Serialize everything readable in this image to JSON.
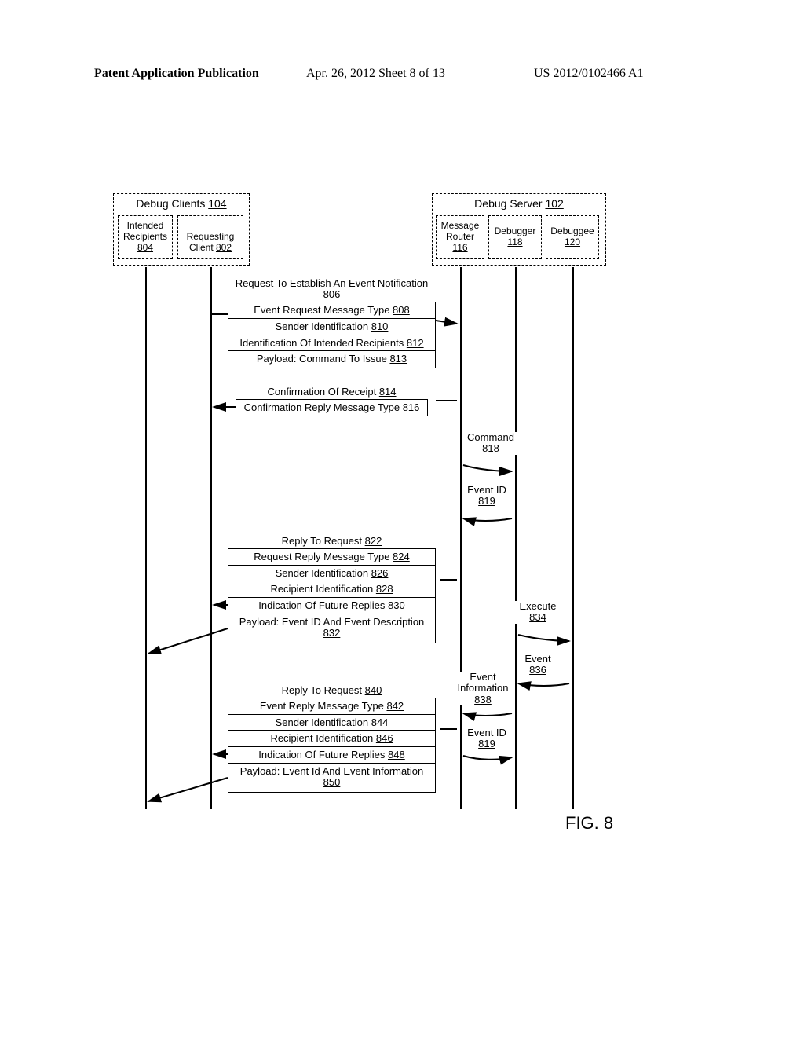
{
  "header": {
    "left": "Patent Application Publication",
    "mid": "Apr. 26, 2012  Sheet 8 of 13",
    "right": "US 2012/0102466 A1"
  },
  "clients": {
    "title": "Debug Clients ",
    "ref": "104",
    "intended_label": "Intended\nRecipients",
    "intended_ref": "804",
    "requesting_label": "Requesting\nClient ",
    "requesting_ref": "802"
  },
  "server": {
    "title": "Debug Server ",
    "ref": "102",
    "router_label": "Message\nRouter",
    "router_ref": "116",
    "debugger_label": "Debugger",
    "debugger_ref": "118",
    "debuggee_label": "Debuggee",
    "debuggee_ref": "120"
  },
  "msg806": {
    "title": "Request To Establish An Event Notification ",
    "title_ref": "806",
    "row1": "Event Request Message Type ",
    "row1_ref": "808",
    "row2": "Sender Identification ",
    "row2_ref": "810",
    "row3": "Identification Of Intended Recipients ",
    "row3_ref": "812",
    "row4": "Payload: Command To Issue ",
    "row4_ref": "813"
  },
  "msg814": {
    "title": "Confirmation Of Receipt ",
    "title_ref": "814",
    "row1": "Confirmation Reply Message Type ",
    "row1_ref": "816"
  },
  "cmd818": {
    "label": "Command",
    "ref": "818"
  },
  "evid819": {
    "label": "Event ID",
    "ref": "819"
  },
  "msg822": {
    "title": "Reply To Request ",
    "title_ref": "822",
    "row1": "Request Reply Message Type ",
    "row1_ref": "824",
    "row2": "Sender Identification ",
    "row2_ref": "826",
    "row3": "Recipient Identification ",
    "row3_ref": "828",
    "row4": "Indication Of Future Replies ",
    "row4_ref": "830",
    "row5": "Payload: Event ID And Event Description",
    "row5_ref": "832"
  },
  "exec834": {
    "label": "Execute",
    "ref": "834"
  },
  "event836": {
    "label": "Event",
    "ref": "836"
  },
  "evinfo838": {
    "label": "Event\nInformation",
    "ref": "838"
  },
  "evid819b": {
    "label": "Event ID",
    "ref": "819"
  },
  "msg840": {
    "title": "Reply To Request ",
    "title_ref": "840",
    "row1": "Event Reply Message Type ",
    "row1_ref": "842",
    "row2": "Sender Identification ",
    "row2_ref": "844",
    "row3": "Recipient Identification ",
    "row3_ref": "846",
    "row4": "Indication Of Future Replies ",
    "row4_ref": "848",
    "row5": "Payload: Event Id And Event Information",
    "row5_ref": "850"
  },
  "figure_label": "FIG. 8"
}
